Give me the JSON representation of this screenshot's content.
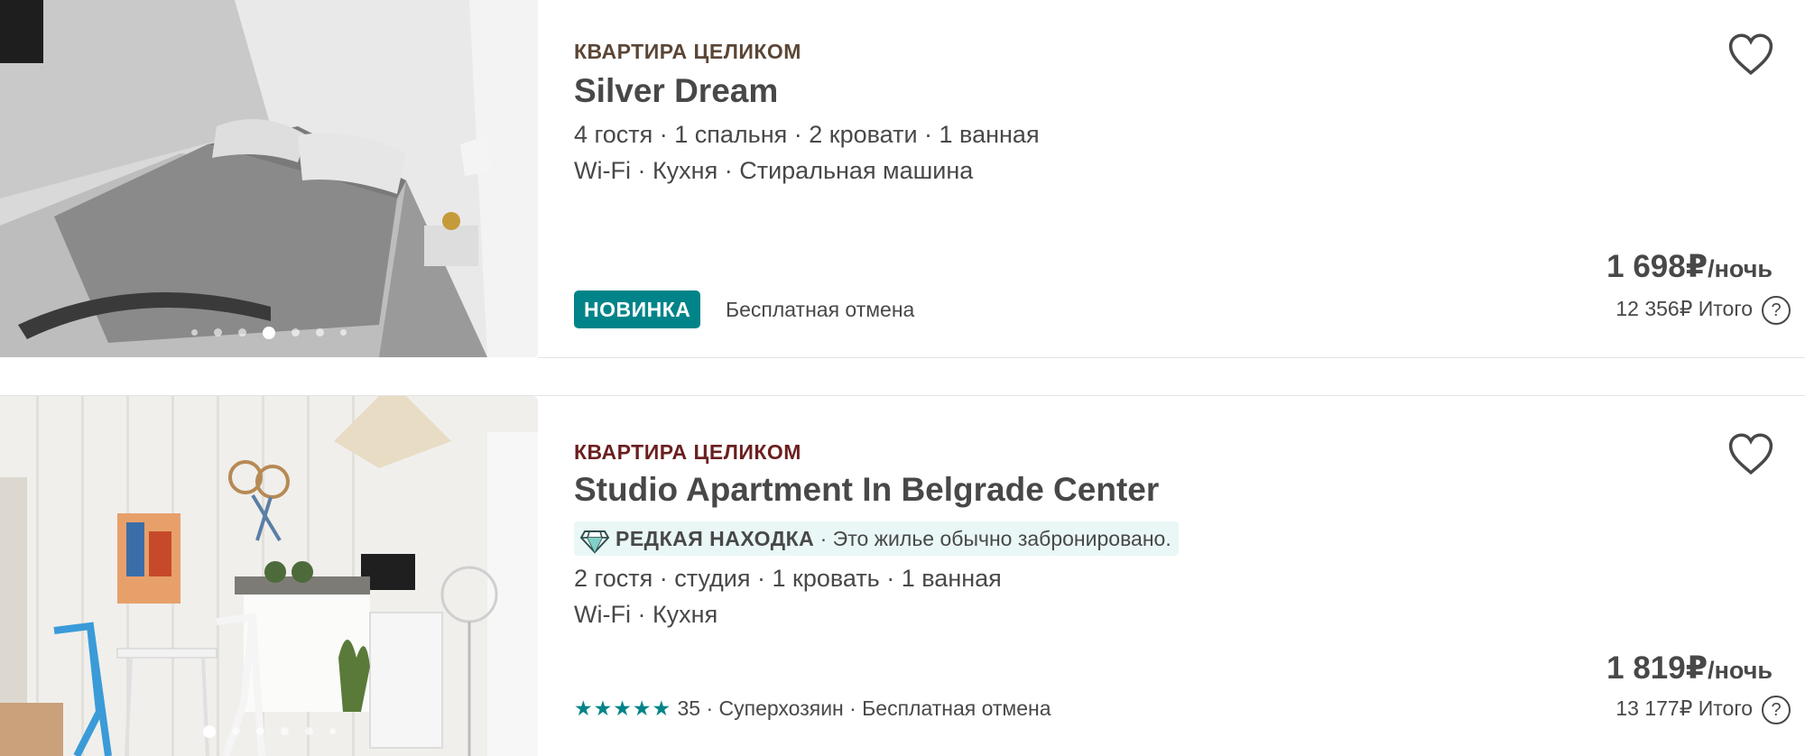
{
  "listings": [
    {
      "type": "КВАРТИРА ЦЕЛИКОМ",
      "title": "Silver Dream",
      "details": "4 гостя · 1 спальня · 2 кровати · 1 ванная",
      "amenities": "Wi-Fi · Кухня · Стиральная машина",
      "badge": "НОВИНКА",
      "cancellation": "Бесплатная отмена",
      "price": "1 698₽",
      "per_night": "/ночь",
      "total": "12 356₽ Итого",
      "help_icon": "?",
      "photo_index": 4,
      "photo_count": 7
    },
    {
      "type": "КВАРТИРА ЦЕЛИКОМ",
      "title": "Studio Apartment In Belgrade Center",
      "rare_label": "РЕДКАЯ НАХОДКА",
      "rare_text": " · Это жилье обычно забронировано.",
      "details": "2 гостя · студия · 1 кровать · 1 ванная",
      "amenities": "Wi-Fi · Кухня",
      "stars": "★★★★★",
      "rating_count": 35,
      "review_count": "35",
      "host_and_cancel": " · Суперхозяин · Бесплатная отмена",
      "price": "1 819₽",
      "per_night": "/ночь",
      "total": "13 177₽ Итого",
      "help_icon": "?",
      "photo_index": 1,
      "photo_count": 6
    }
  ],
  "colors": {
    "accent": "#008489",
    "text": "#484848",
    "type_label_1": "#5b4636",
    "type_label_2": "#6b1f1f",
    "rare_bg": "#e9f7f6"
  },
  "icons": [
    "heart-icon",
    "gem-icon",
    "star-icon",
    "help-icon"
  ]
}
